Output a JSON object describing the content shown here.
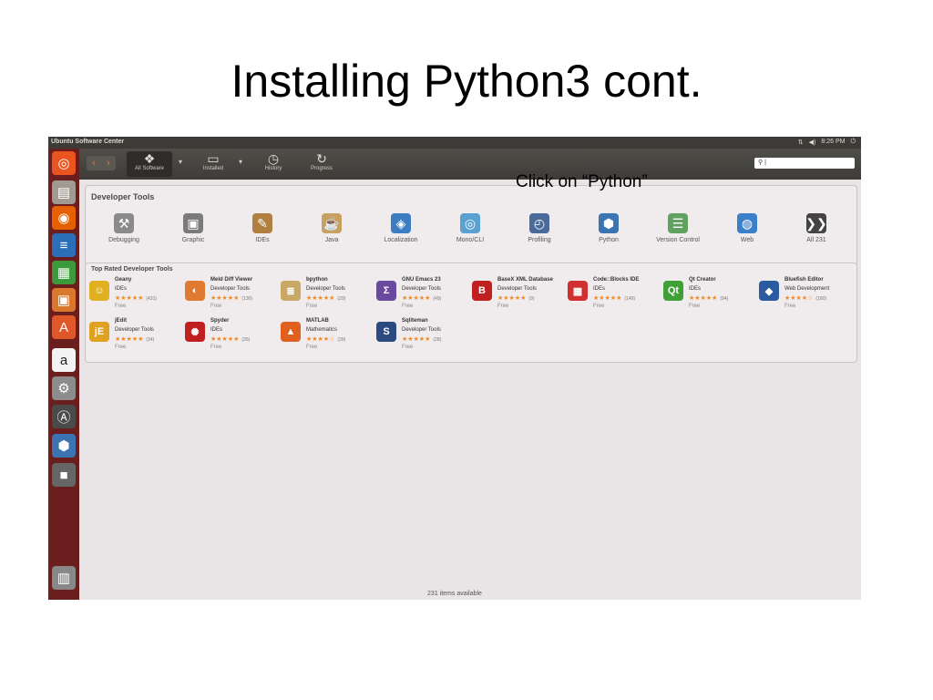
{
  "slide": {
    "title": "Installing Python3 cont.",
    "annotation": "Click on “Python”"
  },
  "window": {
    "title": "Ubuntu Software Center",
    "clock": "8:26 PM",
    "tray_icons": [
      "network-icon",
      "volume-icon",
      "power-icon"
    ]
  },
  "toolbar": {
    "items": [
      {
        "label": "All Software",
        "icon": "package-icon",
        "glyph": "❖",
        "active": true
      },
      {
        "label": "Installed",
        "icon": "monitor-icon",
        "glyph": "▭",
        "active": false
      },
      {
        "label": "History",
        "icon": "clock-icon",
        "glyph": "◷",
        "active": false
      },
      {
        "label": "Progress",
        "icon": "refresh-icon",
        "glyph": "↻",
        "active": false
      }
    ],
    "search_value": "|"
  },
  "launcher": {
    "items": [
      {
        "name": "dash",
        "glyph": "◎",
        "color": "#e95420"
      },
      {
        "name": "files",
        "glyph": "▤",
        "color": "#a09a91"
      },
      {
        "name": "firefox",
        "glyph": "◉",
        "color": "#e66000"
      },
      {
        "name": "writer",
        "glyph": "≡",
        "color": "#2a6fb8"
      },
      {
        "name": "calc",
        "glyph": "▦",
        "color": "#3c9a3c"
      },
      {
        "name": "impress",
        "glyph": "▣",
        "color": "#d9782d"
      },
      {
        "name": "software-center",
        "glyph": "A",
        "color": "#e0572a"
      },
      {
        "name": "amazon",
        "glyph": "a",
        "color": "#f3f3f3"
      },
      {
        "name": "settings",
        "glyph": "⚙",
        "color": "#8c8c8c"
      },
      {
        "name": "updater",
        "glyph": "Ⓐ",
        "color": "#4a4a4a"
      },
      {
        "name": "python",
        "glyph": "⬢",
        "color": "#3b74b0"
      },
      {
        "name": "drive",
        "glyph": "■",
        "color": "#666666"
      },
      {
        "name": "trash",
        "glyph": "▥",
        "color": "#888888"
      }
    ]
  },
  "developer_tools": {
    "title": "Developer Tools",
    "categories": [
      {
        "label": "Debugging",
        "icon": "debugging-icon",
        "glyph": "⚒",
        "color": "#8a8a8a"
      },
      {
        "label": "Graphic",
        "icon": "graphic-icon",
        "glyph": "▣",
        "color": "#7a7a7a"
      },
      {
        "label": "IDEs",
        "icon": "ides-icon",
        "glyph": "✎",
        "color": "#b08040"
      },
      {
        "label": "Java",
        "icon": "java-icon",
        "glyph": "☕",
        "color": "#c8a060"
      },
      {
        "label": "Localization",
        "icon": "localization-icon",
        "glyph": "◈",
        "color": "#3c7cc0"
      },
      {
        "label": "Mono/CLI",
        "icon": "mono-icon",
        "glyph": "◎",
        "color": "#5aa0d0"
      },
      {
        "label": "Profiling",
        "icon": "profiling-icon",
        "glyph": "◴",
        "color": "#4a6a9a"
      },
      {
        "label": "Python",
        "icon": "python-icon",
        "glyph": "⬢",
        "color": "#3b74b0"
      },
      {
        "label": "Version Control",
        "icon": "version-control-icon",
        "glyph": "☰",
        "color": "#60a060"
      },
      {
        "label": "Web",
        "icon": "web-icon",
        "glyph": "◍",
        "color": "#3a80c8"
      },
      {
        "label": "All 231",
        "icon": "chevrons-icon",
        "glyph": "❯❯",
        "color": "#444444"
      }
    ]
  },
  "top_rated": {
    "title": "Top Rated Developer Tools",
    "apps": [
      {
        "name": "Geany",
        "category": "IDEs",
        "stars": "★★★★★",
        "count": "(431)",
        "price": "Free",
        "icon": "geany-icon",
        "glyph": "☺",
        "color": "#e0b020"
      },
      {
        "name": "Meld Diff Viewer",
        "category": "Developer Tools",
        "stars": "★★★★★",
        "count": "(130)",
        "price": "Free",
        "icon": "meld-icon",
        "glyph": "◐",
        "color": "#e07a30"
      },
      {
        "name": "bpython",
        "category": "Developer Tools",
        "stars": "★★★★★",
        "count": "(29)",
        "price": "Free",
        "icon": "bpython-icon",
        "glyph": "≣",
        "color": "#c8a864"
      },
      {
        "name": "GNU Emacs 23",
        "category": "Developer Tools",
        "stars": "★★★★★",
        "count": "(49)",
        "price": "Free",
        "icon": "emacs-icon",
        "glyph": "Σ",
        "color": "#6a4aa0"
      },
      {
        "name": "BaseX XML Database",
        "category": "Developer Tools",
        "stars": "★★★★★",
        "count": "(9)",
        "price": "Free",
        "icon": "basex-icon",
        "glyph": "B",
        "color": "#c02020"
      },
      {
        "name": "Code::Blocks IDE",
        "category": "IDEs",
        "stars": "★★★★★",
        "count": "(149)",
        "price": "Free",
        "icon": "codeblocks-icon",
        "glyph": "▦",
        "color": "#d03030"
      },
      {
        "name": "Qt Creator",
        "category": "IDEs",
        "stars": "★★★★★",
        "count": "(94)",
        "price": "Free",
        "icon": "qt-creator-icon",
        "glyph": "Qt",
        "color": "#41a035"
      },
      {
        "name": "Bluefish Editor",
        "category": "Web Development",
        "stars": "★★★★☆",
        "count": "(180)",
        "price": "Free",
        "icon": "bluefish-icon",
        "glyph": "◆",
        "color": "#2a5aa0"
      },
      {
        "name": "jEdit",
        "category": "Developer Tools",
        "stars": "★★★★★",
        "count": "(34)",
        "price": "Free",
        "icon": "jedit-icon",
        "glyph": "jE",
        "color": "#e0a020"
      },
      {
        "name": "Spyder",
        "category": "IDEs",
        "stars": "★★★★★",
        "count": "(35)",
        "price": "Free",
        "icon": "spyder-icon",
        "glyph": "✺",
        "color": "#c02020"
      },
      {
        "name": "MATLAB",
        "category": "Mathematics",
        "stars": "★★★★☆",
        "count": "(39)",
        "price": "Free",
        "icon": "matlab-icon",
        "glyph": "▲",
        "color": "#e06020"
      },
      {
        "name": "Sqliteman",
        "category": "Developer Tools",
        "stars": "★★★★★",
        "count": "(28)",
        "price": "Free",
        "icon": "sqliteman-icon",
        "glyph": "S",
        "color": "#2a4a80"
      }
    ]
  },
  "status_bar": {
    "text": "231 items available"
  }
}
